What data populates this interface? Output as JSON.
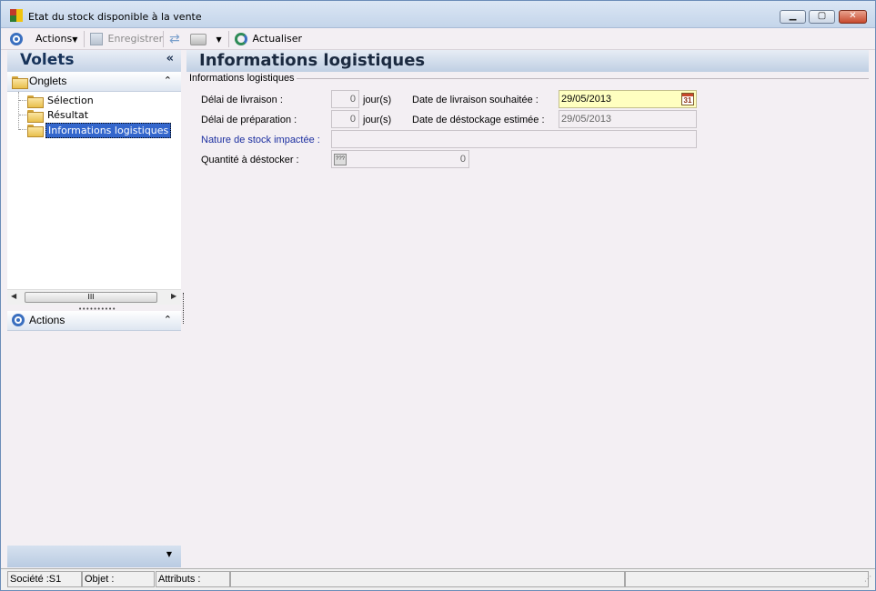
{
  "window": {
    "title": "Etat du stock disponible à la vente"
  },
  "titlebar_buttons": {
    "minimize": "▁",
    "maximize": "▢",
    "close": "✕"
  },
  "toolbar": {
    "actions_label": "Actions",
    "save_label": "Enregistrer",
    "refresh_label": "Actualiser"
  },
  "left": {
    "header": "Volets",
    "collapse_glyph": "«",
    "onglets": {
      "label": "Onglets",
      "items": [
        {
          "label": "Sélection"
        },
        {
          "label": "Résultat"
        },
        {
          "label": "Informations logistiques",
          "selected": true
        }
      ]
    },
    "actions": {
      "label": "Actions"
    },
    "scroll_grip": "III"
  },
  "main": {
    "header": "Informations logistiques",
    "fieldset_label": "Informations logistiques",
    "fields": {
      "delai_livraison": {
        "label": "Délai de livraison :",
        "value": "0",
        "unit": "jour(s)"
      },
      "delai_preparation": {
        "label": "Délai de préparation :",
        "value": "0",
        "unit": "jour(s)"
      },
      "date_livraison": {
        "label": "Date de livraison souhaitée :",
        "value": "29/05/2013",
        "calendar": "31"
      },
      "date_destockage": {
        "label": "Date de déstockage estimée :",
        "value": "29/05/2013"
      },
      "nature_stock": {
        "label": "Nature de stock impactée :",
        "value": ""
      },
      "quantite": {
        "label": "Quantité à déstocker :",
        "value": "0",
        "icon_text": "???"
      }
    }
  },
  "status": {
    "societe": "Société :S1",
    "objet": "Objet :",
    "attributs": "Attributs :"
  },
  "colors": {
    "accent": "#3a6fbf",
    "header_text": "#17335a",
    "highlight": "#ffffc0",
    "selected": "#3366cc"
  }
}
